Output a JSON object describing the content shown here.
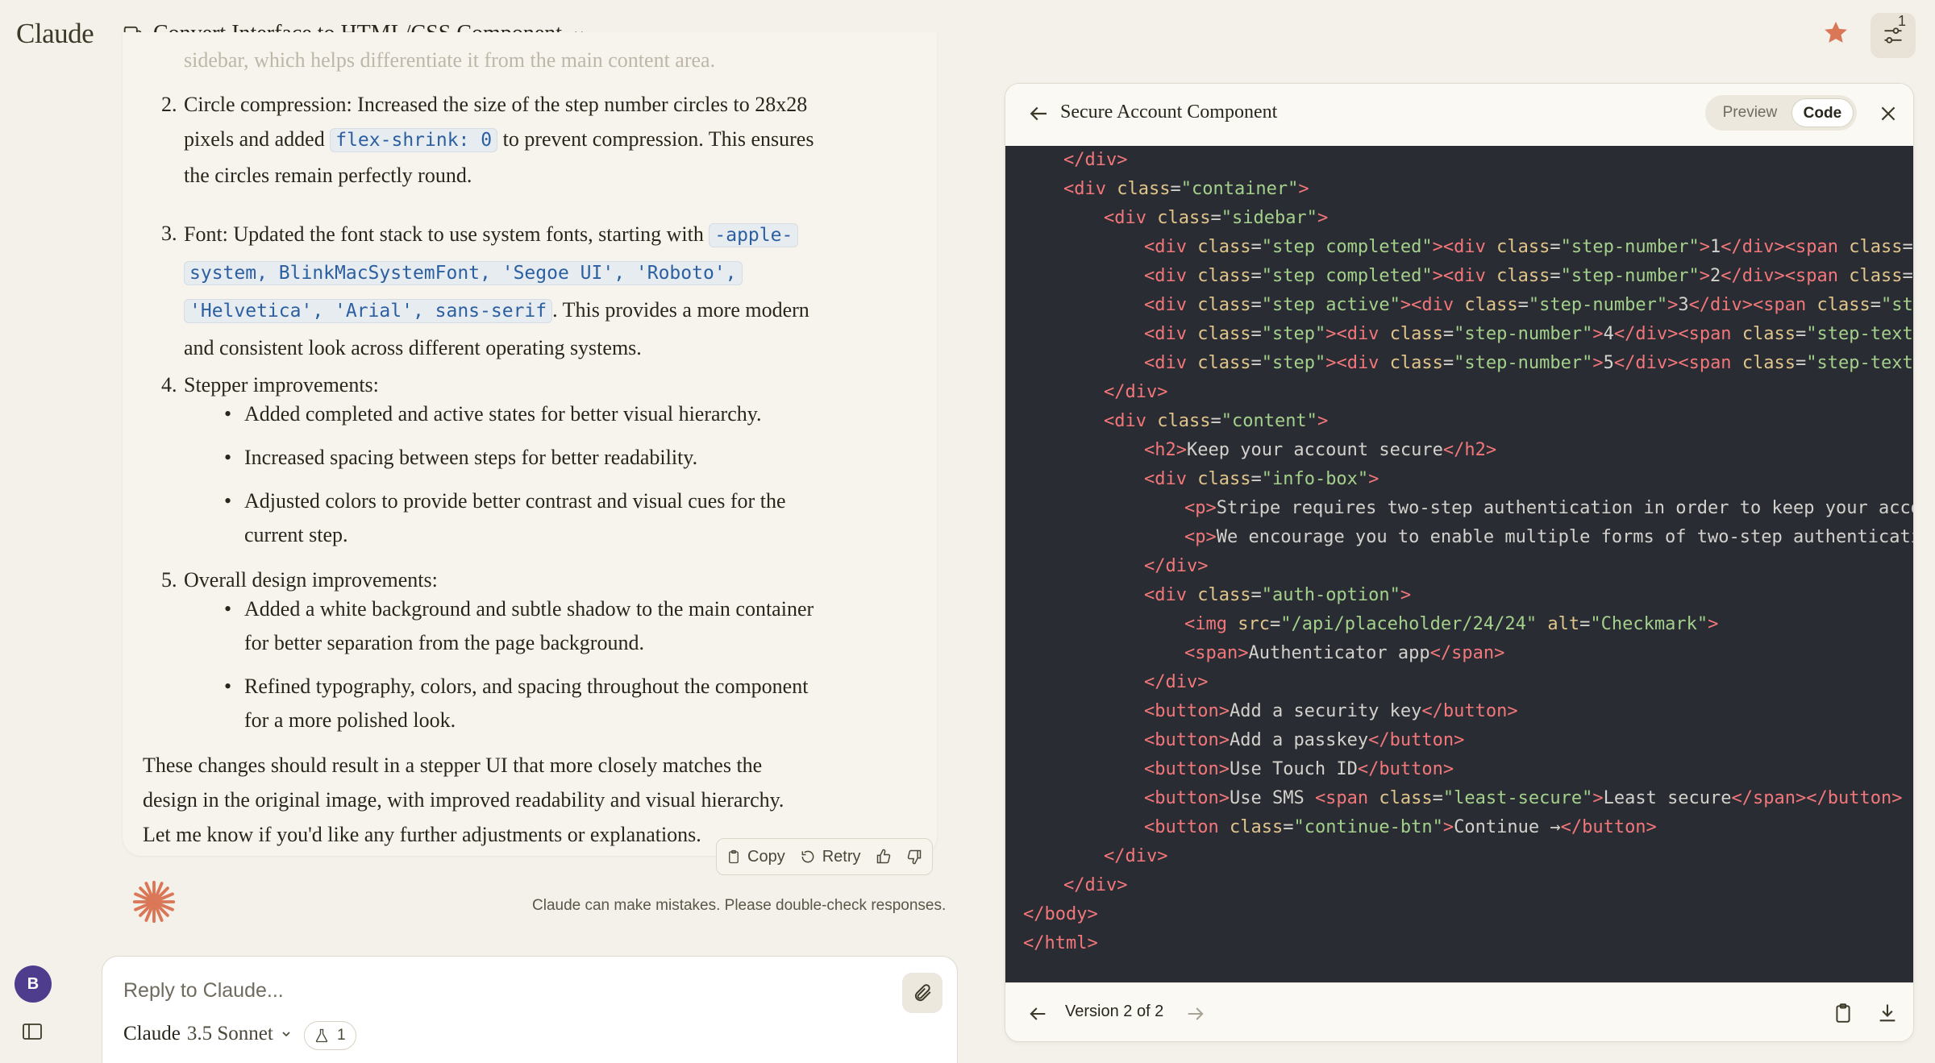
{
  "app": {
    "logo": "Claude",
    "conversation_title": "Convert Interface to HTML/CSS Component",
    "settings_badge": "1"
  },
  "message": {
    "faded_line": "sidebar, which helps differentiate it from the main content area.",
    "item2": {
      "num": "2.",
      "lines": [
        "Circle compression: Increased the size of the step number circles to 28x28",
        "pixels and added ",
        "flex-shrink: 0",
        " to prevent compression. This ensures",
        "the circles remain perfectly round."
      ]
    },
    "item3": {
      "num": "3.",
      "line1": "Font: Updated the font stack to use system fonts, starting with ",
      "code1": "-apple-",
      "code2": "system, BlinkMacSystemFont, 'Segoe UI', 'Roboto',",
      "code3": "'Helvetica', 'Arial', sans-serif",
      "after": ". This provides a more modern",
      "line4": "and consistent look across different operating systems."
    },
    "item4": {
      "num": "4.",
      "title": "Stepper improvements:",
      "bullets": [
        "Added completed and active states for better visual hierarchy.",
        "Increased spacing between steps for better readability.",
        "Adjusted colors to provide better contrast and visual cues for the",
        "current step."
      ]
    },
    "item5": {
      "num": "5.",
      "title": "Overall design improvements:",
      "bullets": [
        "Added a white background and subtle shadow to the main container",
        "for better separation from the page background.",
        "Refined typography, colors, and spacing throughout the component",
        "for a more polished look."
      ]
    },
    "closing": [
      "These changes should result in a stepper UI that more closely matches the",
      "design in the original image, with improved readability and visual hierarchy.",
      "Let me know if you'd like any further adjustments or explanations."
    ],
    "actions": {
      "copy": "Copy",
      "retry": "Retry"
    },
    "disclaimer": "Claude can make mistakes. Please double-check responses."
  },
  "user": {
    "avatar_initial": "B"
  },
  "reply": {
    "placeholder": "Reply to Claude...",
    "model_name": "Claude",
    "model_version": "3.5 Sonnet",
    "flask_count": "1"
  },
  "artifact": {
    "title": "Secure Account Component",
    "toggle_preview": "Preview",
    "toggle_code": "Code",
    "version": "Version 2 of 2",
    "code_lines": [
      {
        "indent": 1,
        "html": "<span class='t'>&lt;/div&gt;</span>"
      },
      {
        "indent": 1,
        "html": "<span class='t'>&lt;div</span> <span class='a'>class</span>=<span class='s'>\"container\"</span><span class='t'>&gt;</span>"
      },
      {
        "indent": 2,
        "html": "<span class='t'>&lt;div</span> <span class='a'>class</span>=<span class='s'>\"sidebar\"</span><span class='t'>&gt;</span>"
      },
      {
        "indent": 3,
        "html": "<span class='t'>&lt;div</span> <span class='a'>class</span>=<span class='s'>\"step completed\"</span><span class='t'>&gt;&lt;div</span> <span class='a'>class</span>=<span class='s'>\"step-number\"</span><span class='t'>&gt;</span>1<span class='t'>&lt;/div&gt;&lt;span</span> <span class='a'>class</span>=<span class='s'>\"st</span>"
      },
      {
        "indent": 3,
        "html": "<span class='t'>&lt;div</span> <span class='a'>class</span>=<span class='s'>\"step completed\"</span><span class='t'>&gt;&lt;div</span> <span class='a'>class</span>=<span class='s'>\"step-number\"</span><span class='t'>&gt;</span>2<span class='t'>&lt;/div&gt;&lt;span</span> <span class='a'>class</span>=<span class='s'>\"st</span>"
      },
      {
        "indent": 3,
        "html": "<span class='t'>&lt;div</span> <span class='a'>class</span>=<span class='s'>\"step active\"</span><span class='t'>&gt;&lt;div</span> <span class='a'>class</span>=<span class='s'>\"step-number\"</span><span class='t'>&gt;</span>3<span class='t'>&lt;/div&gt;&lt;span</span> <span class='a'>class</span>=<span class='s'>\"step-</span>"
      },
      {
        "indent": 3,
        "html": "<span class='t'>&lt;div</span> <span class='a'>class</span>=<span class='s'>\"step\"</span><span class='t'>&gt;&lt;div</span> <span class='a'>class</span>=<span class='s'>\"step-number\"</span><span class='t'>&gt;</span>4<span class='t'>&lt;/div&gt;&lt;span</span> <span class='a'>class</span>=<span class='s'>\"step-text\"</span><span class='t'>&gt;</span>A"
      },
      {
        "indent": 3,
        "html": "<span class='t'>&lt;div</span> <span class='a'>class</span>=<span class='s'>\"step\"</span><span class='t'>&gt;&lt;div</span> <span class='a'>class</span>=<span class='s'>\"step-number\"</span><span class='t'>&gt;</span>5<span class='t'>&lt;/div&gt;&lt;span</span> <span class='a'>class</span>=<span class='s'>\"step-text\"</span><span class='t'>&gt;</span>R"
      },
      {
        "indent": 2,
        "html": "<span class='t'>&lt;/div&gt;</span>"
      },
      {
        "indent": 2,
        "html": "<span class='t'>&lt;div</span> <span class='a'>class</span>=<span class='s'>\"content\"</span><span class='t'>&gt;</span>"
      },
      {
        "indent": 3,
        "html": "<span class='t'>&lt;h2&gt;</span>Keep your account secure<span class='t'>&lt;/h2&gt;</span>"
      },
      {
        "indent": 3,
        "html": "<span class='t'>&lt;div</span> <span class='a'>class</span>=<span class='s'>\"info-box\"</span><span class='t'>&gt;</span>"
      },
      {
        "indent": 4,
        "html": "<span class='t'>&lt;p&gt;</span>Stripe requires two-step authentication in order to keep your accoun"
      },
      {
        "indent": 4,
        "html": "<span class='t'>&lt;p&gt;</span>We encourage you to enable multiple forms of two-step authentication"
      },
      {
        "indent": 3,
        "html": "<span class='t'>&lt;/div&gt;</span>"
      },
      {
        "indent": 3,
        "html": "<span class='t'>&lt;div</span> <span class='a'>class</span>=<span class='s'>\"auth-option\"</span><span class='t'>&gt;</span>"
      },
      {
        "indent": 4,
        "html": "<span class='t'>&lt;img</span> <span class='a'>src</span>=<span class='s'>\"/api/placeholder/24/24\"</span> <span class='a'>alt</span>=<span class='s'>\"Checkmark\"</span><span class='t'>&gt;</span>"
      },
      {
        "indent": 4,
        "html": "<span class='t'>&lt;span&gt;</span>Authenticator app<span class='t'>&lt;/span&gt;</span>"
      },
      {
        "indent": 3,
        "html": "<span class='t'>&lt;/div&gt;</span>"
      },
      {
        "indent": 3,
        "html": "<span class='t'>&lt;button&gt;</span>Add a security key<span class='t'>&lt;/button&gt;</span>"
      },
      {
        "indent": 3,
        "html": "<span class='t'>&lt;button&gt;</span>Add a passkey<span class='t'>&lt;/button&gt;</span>"
      },
      {
        "indent": 3,
        "html": "<span class='t'>&lt;button&gt;</span>Use Touch ID<span class='t'>&lt;/button&gt;</span>"
      },
      {
        "indent": 3,
        "html": "<span class='t'>&lt;button&gt;</span>Use SMS <span class='t'>&lt;span</span> <span class='a'>class</span>=<span class='s'>\"least-secure\"</span><span class='t'>&gt;</span>Least secure<span class='t'>&lt;/span&gt;&lt;/button&gt;</span>"
      },
      {
        "indent": 3,
        "html": "<span class='t'>&lt;button</span> <span class='a'>class</span>=<span class='s'>\"continue-btn\"</span><span class='t'>&gt;</span>Continue →<span class='t'>&lt;/button&gt;</span>"
      },
      {
        "indent": 2,
        "html": "<span class='t'>&lt;/div&gt;</span>"
      },
      {
        "indent": 1,
        "html": "<span class='t'>&lt;/div&gt;</span>"
      },
      {
        "indent": 0,
        "html": "<span class='t'>&lt;/body&gt;</span>"
      },
      {
        "indent": 0,
        "html": "<span class='t'>&lt;/html&gt;</span>"
      }
    ]
  },
  "colors": {
    "background": "#f4f1ea",
    "code_bg": "#2a2c33",
    "tag": "#f2777a",
    "attr": "#e0c48a",
    "string": "#a3d08a",
    "accent": "#d97757"
  }
}
